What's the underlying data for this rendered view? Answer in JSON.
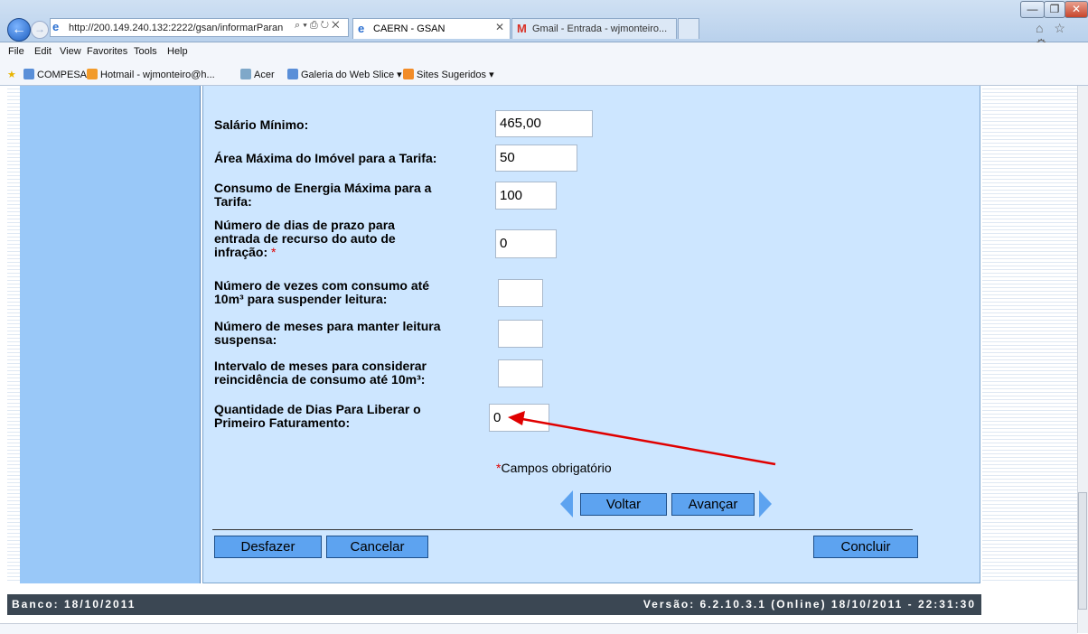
{
  "browser": {
    "address": "http://200.149.240.132:2222/gsan/informarParan",
    "address_actions": "⌕ ▾ ⎙ ↻ ✕",
    "tabs": [
      {
        "title": "CAERN - GSAN",
        "active": true
      },
      {
        "title": "Gmail - Entrada - wjmonteiro...",
        "active": false
      }
    ],
    "tab_close": "✕",
    "window_buttons": [
      "—",
      "❐",
      "✕"
    ],
    "right_icons": "⌂ ☆ ⚙"
  },
  "menu": [
    "File",
    "Edit",
    "View",
    "Favorites",
    "Tools",
    "Help"
  ],
  "favorites": [
    {
      "label": "COMPESA",
      "icon": "ie-page-icon"
    },
    {
      "label": "Hotmail - wjmonteiro@h...",
      "icon": "hotmail-icon"
    },
    {
      "label": "Acer",
      "icon": "acer-icon"
    },
    {
      "label": "Galeria do Web Slice ▾",
      "icon": "ie-page-icon"
    },
    {
      "label": "Sites Sugeridos ▾",
      "icon": "suggested-sites-icon"
    }
  ],
  "form": {
    "salario_minimo": {
      "label": "Salário Mínimo:",
      "value": "465,00"
    },
    "area_maxima": {
      "label": "Área Máxima do Imóvel para a Tarifa:",
      "value": "50"
    },
    "consumo_energia": {
      "label_l1": "Consumo de Energia Máxima para a",
      "label_l2": "Tarifa:",
      "value": "100"
    },
    "dias_recurso": {
      "label_l1": "Número de dias de prazo para",
      "label_l2": "entrada de recurso do auto de",
      "label_l3": "infração:",
      "required_mark": "*",
      "value": "0"
    },
    "vezes_consumo": {
      "label_l1": "Número de vezes com consumo até",
      "label_l2": "10m³ para suspender leitura:",
      "value": ""
    },
    "meses_leitura": {
      "label_l1": "Número de meses para manter leitura",
      "label_l2": "suspensa:",
      "value": ""
    },
    "intervalo_meses": {
      "label_l1": "Intervalo de meses para considerar",
      "label_l2": "reincidência de consumo até 10m³:",
      "value": ""
    },
    "dias_faturamento": {
      "label_l1": "Quantidade de Dias Para Liberar o",
      "label_l2": "Primeiro Faturamento:",
      "value": "0"
    },
    "required_note_mark": "*",
    "required_note": "Campos obrigatório"
  },
  "nav": {
    "back": "Voltar",
    "next": "Avançar"
  },
  "actions": {
    "undo": "Desfazer",
    "cancel": "Cancelar",
    "finish": "Concluir"
  },
  "footer": {
    "bank": "Banco: 18/10/2011",
    "version": "Versão: 6.2.10.3.1 (Online) 18/10/2011 - 22:31:30"
  },
  "colors": {
    "content_bg": "#cde6ff",
    "sidebar_bg": "#99c8f8",
    "button_bg": "#5da3f0",
    "footer_bg": "#3b4753",
    "annotation_arrow": "#e00000"
  }
}
